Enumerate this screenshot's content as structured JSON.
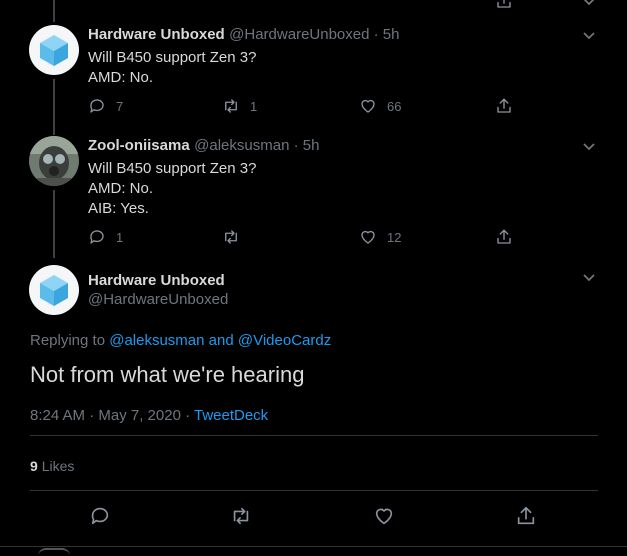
{
  "tweets": [
    {
      "author": "Hardware Unboxed",
      "handle_time": "@HardwareUnboxed · 5h",
      "lines": [
        "Will B450 support Zen 3?",
        "AMD: No."
      ],
      "replies": "7",
      "retweets": "1",
      "likes": "66"
    },
    {
      "author": "Zool-oniisama",
      "handle_time": "@aleksusman · 5h",
      "lines": [
        "Will B450 support Zen 3?",
        "AMD: No.",
        "AIB: Yes."
      ],
      "replies": "1",
      "retweets": "",
      "likes": "12"
    }
  ],
  "main": {
    "author": "Hardware Unboxed",
    "handle": "@HardwareUnboxed",
    "replying_prefix": "Replying to",
    "replying_user1": "@aleksusman",
    "replying_and": "and",
    "replying_user2": "@VideoCardz",
    "text": "Not from what we're hearing",
    "timestamp": "8:24 AM · May 7, 2020 · ",
    "source": "TweetDeck",
    "likes_count": "9",
    "likes_label": "Likes"
  },
  "icons": {
    "reply": "reply-icon",
    "retweet": "retweet-icon",
    "like": "heart-icon",
    "share": "share-icon",
    "menu": "chevron-down-icon"
  },
  "colors": {
    "background": "#000000",
    "link": "#1d9bf0",
    "muted": "#6e767d",
    "text": "#d9d9d9"
  }
}
